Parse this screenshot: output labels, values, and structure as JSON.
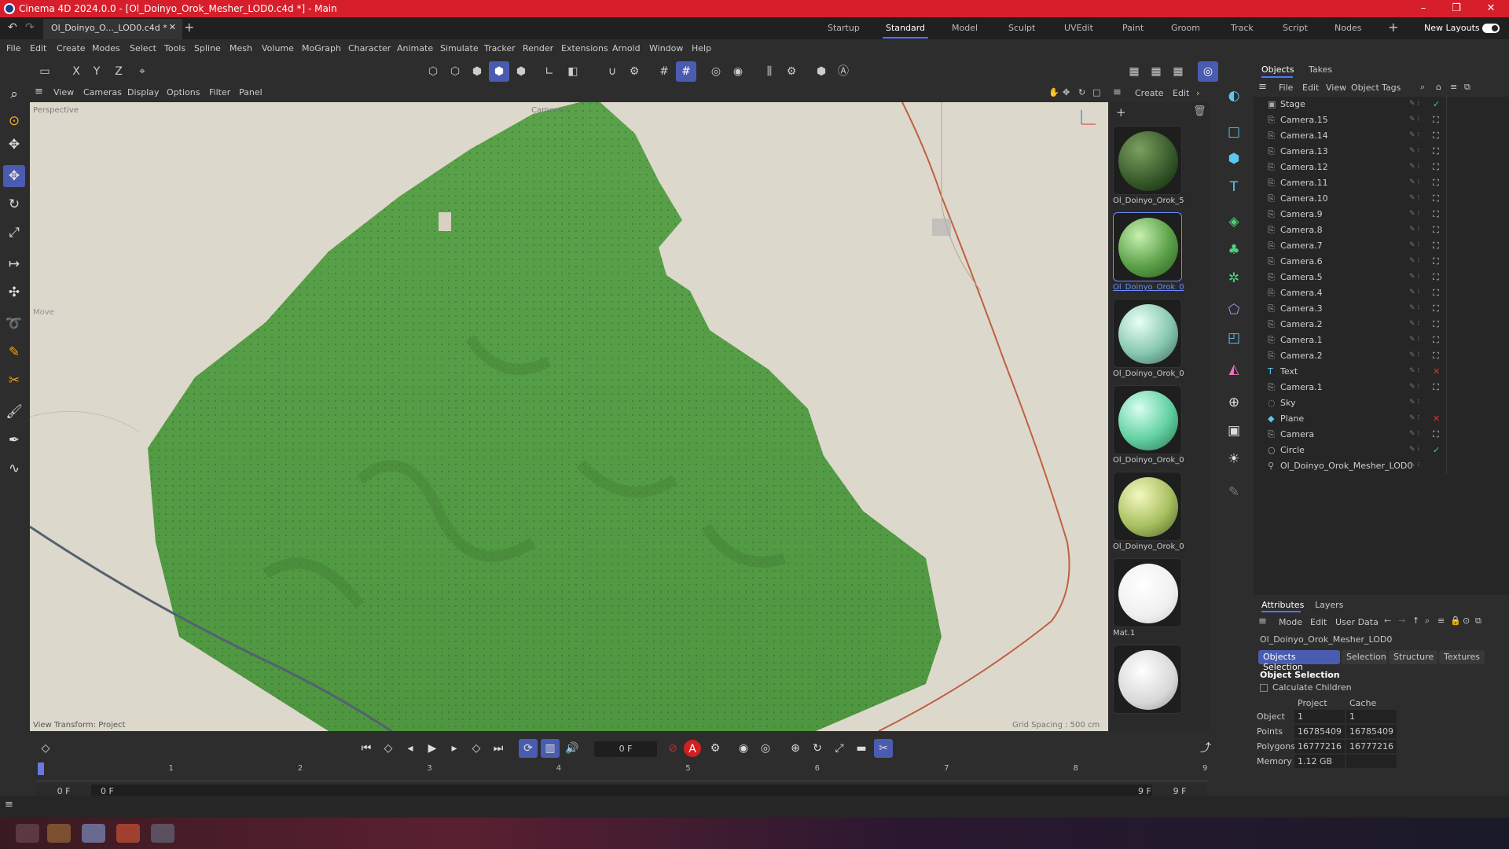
{
  "window": {
    "title": "Cinema 4D 2024.0.0 - [Ol_Doinyo_Orok_Mesher_LOD0.c4d *] - Main"
  },
  "doc_tab": {
    "label": "Ol_Doinyo_O..._LOD0.c4d *"
  },
  "layouts": [
    "Startup",
    "Standard",
    "Model",
    "Sculpt",
    "UVEdit",
    "Paint",
    "Groom",
    "Track",
    "Script",
    "Nodes"
  ],
  "new_layouts": "New Layouts",
  "menu": [
    "File",
    "Edit",
    "Create",
    "Modes",
    "Select",
    "Tools",
    "Spline",
    "Mesh",
    "Volume",
    "MoGraph",
    "Character",
    "Animate",
    "Simulate",
    "Tracker",
    "Render",
    "Extensions",
    "Arnold",
    "Window",
    "Help"
  ],
  "axis": {
    "x": "X",
    "y": "Y",
    "z": "Z"
  },
  "viewport_menu": [
    "View",
    "Cameras",
    "Display",
    "Options",
    "Filter",
    "Panel"
  ],
  "viewport": {
    "mode": "Perspective",
    "camera": "Camera.1",
    "move_label": "Move",
    "transform": "View Transform: Project",
    "grid": "Grid Spacing : 500 cm"
  },
  "mat_menu": [
    "Create",
    "Edit"
  ],
  "materials": [
    {
      "name": "Ol_Doinyo_Orok_5",
      "color": "#3a5a30"
    },
    {
      "name": "Ol_Doinyo_Orok_0",
      "color": "#5aa048"
    },
    {
      "name": "Ol_Doinyo_Orok_0",
      "color": "#88c8b0"
    },
    {
      "name": "Ol_Doinyo_Orok_0",
      "color": "#60d0a0"
    },
    {
      "name": "Ol_Doinyo_Orok_0",
      "color": "#a8c060"
    },
    {
      "name": "Mat.1",
      "color": "#ffffff"
    },
    {
      "name": "",
      "color": "#e0e0e0"
    }
  ],
  "panel_tabs": {
    "objects": "Objects",
    "takes": "Takes"
  },
  "obj_menu": [
    "File",
    "Edit",
    "View",
    "Object",
    "Tags"
  ],
  "objects": [
    "Stage",
    "Camera.15",
    "Camera.14",
    "Camera.13",
    "Camera.12",
    "Camera.11",
    "Camera.10",
    "Camera.9",
    "Camera.8",
    "Camera.7",
    "Camera.6",
    "Camera.5",
    "Camera.4",
    "Camera.3",
    "Camera.2",
    "Camera.1",
    "Camera.2",
    "Text",
    "Camera.1",
    "Sky",
    "Plane",
    "Camera",
    "Circle",
    "Ol_Doinyo_Orok_Mesher_LOD0"
  ],
  "attr_tabs": {
    "attributes": "Attributes",
    "layers": "Layers"
  },
  "attr_menu": [
    "Mode",
    "Edit",
    "User Data"
  ],
  "attr_object": "Ol_Doinyo_Orok_Mesher_LOD0",
  "attr_subtabs": [
    "Objects Selection",
    "Selection",
    "Structure",
    "Textures"
  ],
  "attr_section": "Object Selection",
  "calc_children": "Calculate Children",
  "stats": {
    "headers": [
      "Project",
      "Cache"
    ],
    "rows": [
      {
        "label": "Object",
        "project": "1",
        "cache": "1"
      },
      {
        "label": "Points",
        "project": "16785409",
        "cache": "16785409"
      },
      {
        "label": "Polygons",
        "project": "16777216",
        "cache": "16777216"
      },
      {
        "label": "Memory",
        "project": "1.12 GB",
        "cache": ""
      }
    ]
  },
  "timeline": {
    "frame_field": "0 F",
    "ticks": [
      "0",
      "1",
      "2",
      "3",
      "4",
      "5",
      "6",
      "7",
      "8",
      "9"
    ],
    "start": "0 F",
    "start2": "0 F",
    "end": "9 F",
    "end2": "9 F"
  }
}
